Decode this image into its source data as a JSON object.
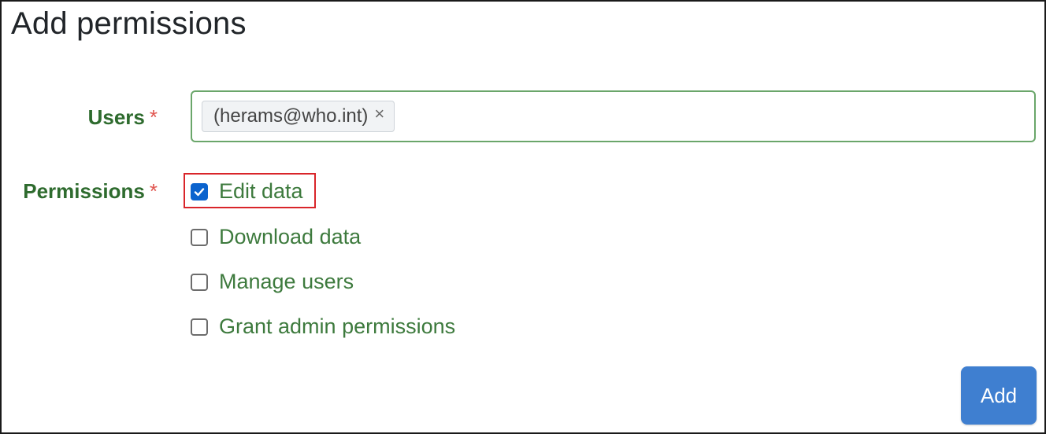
{
  "page": {
    "title": "Add permissions"
  },
  "form": {
    "users": {
      "label": "Users",
      "required_mark": "*",
      "selected": [
        {
          "label": "(herams@who.int)",
          "remove_glyph": "×"
        }
      ]
    },
    "permissions": {
      "label": "Permissions",
      "required_mark": "*",
      "options": [
        {
          "label": "Edit data",
          "checked": true,
          "highlighted": true
        },
        {
          "label": "Download data",
          "checked": false
        },
        {
          "label": "Manage users",
          "checked": false
        },
        {
          "label": "Grant admin permissions",
          "checked": false
        }
      ]
    },
    "submit_label": "Add"
  },
  "colors": {
    "label_green": "#2e6b2e",
    "option_green": "#3d7a3d",
    "required_red": "#e0554f",
    "input_border_green": "#6aa66a",
    "checkbox_blue": "#0b63ce",
    "button_blue": "#3f7fd0",
    "highlight_red": "#d9252a"
  },
  "icons": {
    "checkmark": "check-icon",
    "remove": "close-icon"
  }
}
